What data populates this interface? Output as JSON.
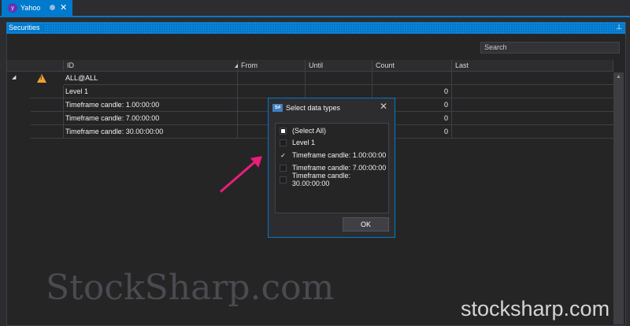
{
  "tab": {
    "title": "Yahoo",
    "close_glyph": "✕",
    "icon": "yahoo-logo-icon"
  },
  "panel": {
    "title": "Securities",
    "pin_glyph": "⊥"
  },
  "search": {
    "placeholder": "Search"
  },
  "grid": {
    "columns": [
      "ID",
      "From",
      "Until",
      "Count",
      "Last"
    ],
    "root": {
      "id": "ALL@ALL",
      "expand_glyph": "◢",
      "warning_glyph": "!"
    },
    "rows": [
      {
        "id": "Level 1",
        "count": "0"
      },
      {
        "id": "Timeframe candle: 1.00:00:00",
        "count": "0"
      },
      {
        "id": "Timeframe candle: 7.00:00:00",
        "count": "0"
      },
      {
        "id": "Timeframe candle: 30.00:00:00",
        "count": "0"
      }
    ]
  },
  "dialog": {
    "title": "Select data types",
    "icon_text": "S#",
    "close_glyph": "✕",
    "items": [
      {
        "label": "(Select All)",
        "mark": ""
      },
      {
        "label": "Level 1",
        "mark": ""
      },
      {
        "label": "Timeframe candle: 1.00:00:00",
        "mark": "✓"
      },
      {
        "label": "Timeframe candle: 7.00:00:00",
        "mark": ""
      },
      {
        "label": "Timeframe candle: 30.00:00:00",
        "mark": ""
      }
    ],
    "ok_label": "OK"
  },
  "watermarks": {
    "serif": "StockSharp.com",
    "sans": "stocksharp.com"
  },
  "colors": {
    "accent": "#007acc",
    "annotation_arrow": "#e91e7a",
    "warning": "#f0a030"
  }
}
